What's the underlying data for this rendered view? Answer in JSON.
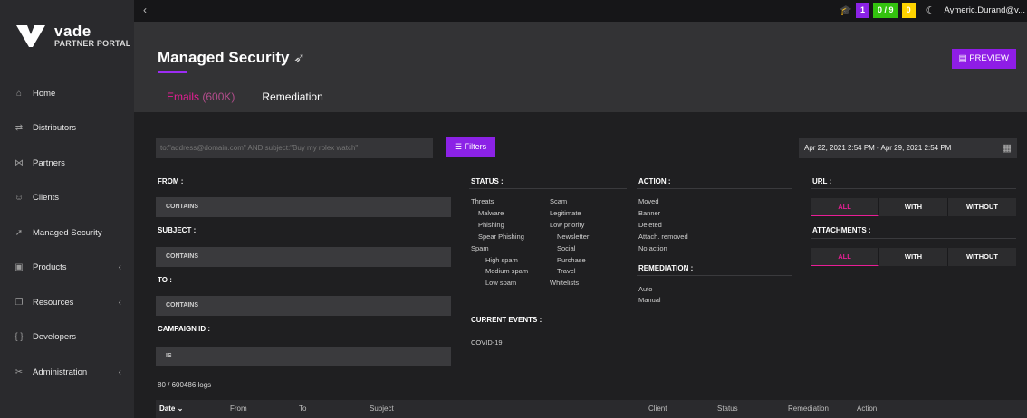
{
  "brand": {
    "name": "vade",
    "subtitle": "PARTNER PORTAL"
  },
  "sidebar": {
    "items": [
      {
        "label": "Home",
        "icon": "home-icon",
        "glyph": "⌂",
        "chevron": false
      },
      {
        "label": "Distributors",
        "icon": "distributors-icon",
        "glyph": "⇄",
        "chevron": false
      },
      {
        "label": "Partners",
        "icon": "partners-icon",
        "glyph": "⋈",
        "chevron": false
      },
      {
        "label": "Clients",
        "icon": "clients-icon",
        "glyph": "☺",
        "chevron": false
      },
      {
        "label": "Managed Security",
        "icon": "managed-security-icon",
        "glyph": "➚",
        "chevron": false
      },
      {
        "label": "Products",
        "icon": "products-icon",
        "glyph": "▣",
        "chevron": true
      },
      {
        "label": "Resources",
        "icon": "resources-icon",
        "glyph": "❐",
        "chevron": true
      },
      {
        "label": "Developers",
        "icon": "developers-icon",
        "glyph": "{ }",
        "chevron": false
      },
      {
        "label": "Administration",
        "icon": "administration-icon",
        "glyph": "✂",
        "chevron": true
      }
    ]
  },
  "topbar": {
    "collapse_glyph": "‹",
    "badge_purple": "1",
    "badge_green": "0 / 9",
    "badge_yellow": "0",
    "user": "Aymeric.Durand@v..."
  },
  "header": {
    "title": "Managed Security",
    "preview_label": "PREVIEW",
    "tabs": [
      {
        "label": "Emails",
        "count": "(600K)"
      },
      {
        "label": "Remediation"
      }
    ]
  },
  "filters": {
    "search_placeholder": "to:\"address@domain.com\" AND subject:\"Buy my rolex watch\"",
    "filters_label": "Filters",
    "date_range": "Apr 22, 2021 2:54 PM - Apr 29, 2021 2:54 PM",
    "from": {
      "title": "FROM :",
      "value": "CONTAINS"
    },
    "subject": {
      "title": "SUBJECT :",
      "value": "CONTAINS"
    },
    "to": {
      "title": "TO :",
      "value": "CONTAINS"
    },
    "campaign": {
      "title": "CAMPAIGN ID :",
      "value": "IS"
    },
    "status_title": "STATUS :",
    "status_col1": [
      "Threats",
      "Malware",
      "Phishing",
      "Spear Phishing",
      "Spam",
      "High spam",
      "Medium spam",
      "Low spam"
    ],
    "status_col2": [
      "Scam",
      "Legitimate",
      "Low priority",
      "Newsletter",
      "Social",
      "Purchase",
      "Travel",
      "Whitelists"
    ],
    "current_events_title": "CURRENT EVENTS :",
    "current_events": [
      "COVID-19"
    ],
    "action_title": "ACTION :",
    "actions": [
      "Moved",
      "Banner",
      "Deleted",
      "Attach. removed",
      "No action"
    ],
    "remediation_title": "REMEDIATION :",
    "remediations": [
      "Auto",
      "Manual"
    ],
    "url_title": "URL :",
    "attachments_title": "ATTACHMENTS :",
    "seg_all": "ALL",
    "seg_with": "WITH",
    "seg_without": "WITHOUT"
  },
  "logs_count": "80 / 600486 logs",
  "table": {
    "columns": [
      "Date",
      "From",
      "To",
      "Subject",
      "Client",
      "Status",
      "Remediation",
      "Action"
    ]
  },
  "colors": {
    "accent": "#8b22e6",
    "pink": "#e91e96",
    "green": "#33c30f",
    "yellow": "#ffd400"
  }
}
